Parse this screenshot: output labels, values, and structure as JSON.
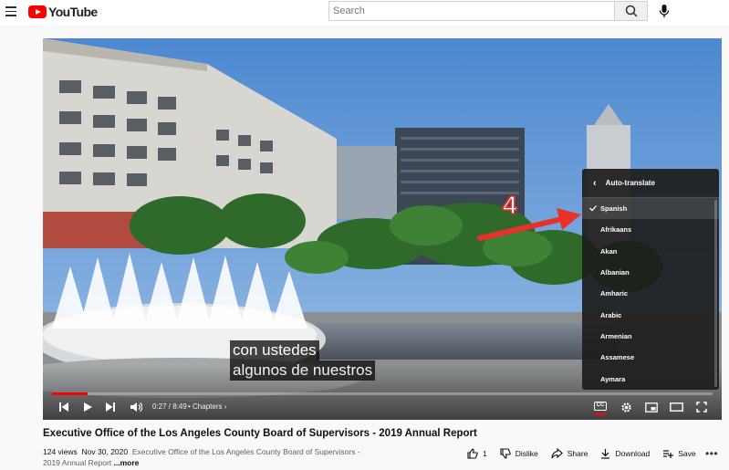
{
  "header": {
    "logo_text": "YouTube",
    "search_placeholder": "Search"
  },
  "player": {
    "captions": [
      "con ustedes",
      "algunos de nuestros"
    ],
    "time": "0:27 / 8:49",
    "chapters_label": "• Chapters ›",
    "cc_label": "CC",
    "progress_played_percent": 5.4
  },
  "settings_menu": {
    "title": "Auto-translate",
    "selected": "Spanish",
    "languages": [
      "Spanish",
      "Afrikaans",
      "Akan",
      "Albanian",
      "Amharic",
      "Arabic",
      "Armenian",
      "Assamese",
      "Aymara"
    ]
  },
  "annotation": {
    "step_number": "4",
    "color": "#e8312b"
  },
  "video": {
    "title": "Executive Office of the Los Angeles County Board of Supervisors - 2019 Annual Report",
    "views": "124 views",
    "date": "Nov 30, 2020",
    "description": "Executive Office of the Los Angeles County Board of Supervisors - 2019 Annual Report",
    "more_label": "...more"
  },
  "actions": {
    "like_count": "1",
    "dislike_label": "Dislike",
    "share_label": "Share",
    "download_label": "Download",
    "save_label": "Save"
  },
  "colors": {
    "brand_red": "#ff0000",
    "menu_bg": "#1c1c1c"
  }
}
